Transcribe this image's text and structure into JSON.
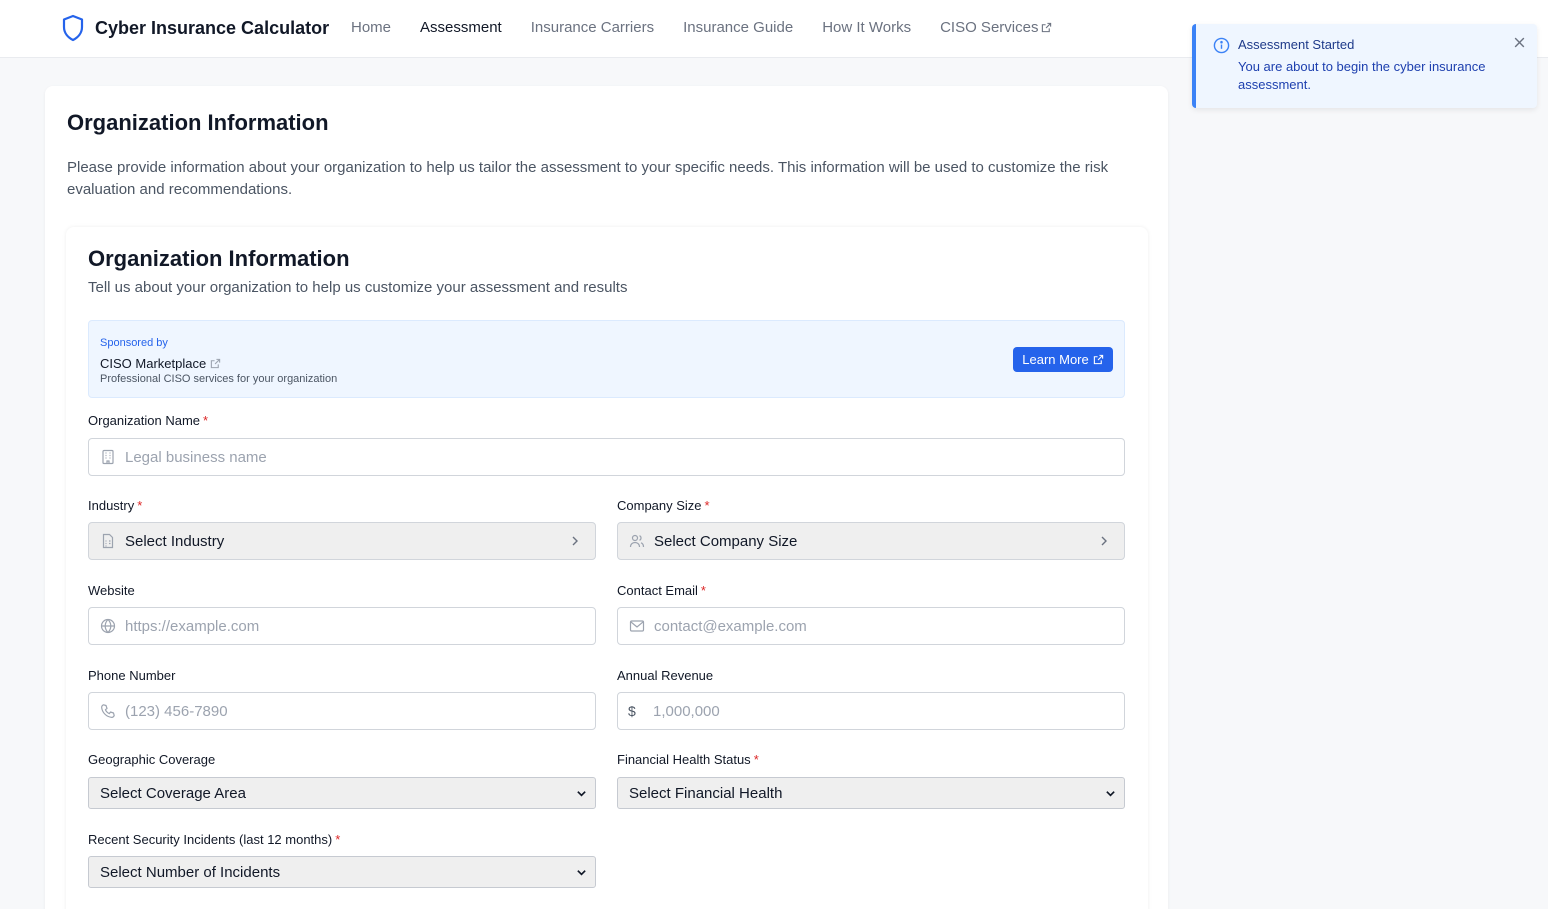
{
  "header": {
    "brand": "Cyber Insurance Calculator",
    "nav": [
      {
        "label": "Home"
      },
      {
        "label": "Assessment",
        "active": true
      },
      {
        "label": "Insurance Carriers"
      },
      {
        "label": "Insurance Guide"
      },
      {
        "label": "How It Works"
      },
      {
        "label": "CISO Services",
        "external": true
      }
    ]
  },
  "toast": {
    "title": "Assessment Started",
    "message": "You are about to begin the cyber insurance assessment."
  },
  "page": {
    "title": "Organization Information",
    "description": "Please provide information about your organization to help us tailor the assessment to your specific needs. This information will be used to customize the risk evaluation and recommendations."
  },
  "form": {
    "title": "Organization Information",
    "subtitle": "Tell us about your organization to help us customize your assessment and results",
    "sponsor": {
      "label": "Sponsored by",
      "name": "CISO Marketplace",
      "description": "Professional CISO services for your organization",
      "button": "Learn More"
    },
    "required_mark": "*",
    "org_name": {
      "label": "Organization Name",
      "placeholder": "Legal business name"
    },
    "industry": {
      "label": "Industry",
      "value": "Select Industry"
    },
    "company_size": {
      "label": "Company Size",
      "value": "Select Company Size"
    },
    "website": {
      "label": "Website",
      "placeholder": "https://example.com"
    },
    "email": {
      "label": "Contact Email",
      "placeholder": "contact@example.com"
    },
    "phone": {
      "label": "Phone Number",
      "placeholder": "(123) 456-7890"
    },
    "revenue": {
      "label": "Annual Revenue",
      "currency": "$",
      "placeholder": "1,000,000"
    },
    "geo": {
      "label": "Geographic Coverage",
      "value": "Select Coverage Area"
    },
    "financial": {
      "label": "Financial Health Status",
      "value": "Select Financial Health"
    },
    "incidents": {
      "label": "Recent Security Incidents (last 12 months)",
      "value": "Select Number of Incidents"
    }
  },
  "colors": {
    "accent": "#2563eb",
    "required": "#dc2626",
    "toast_bg": "#eff6ff",
    "toast_border": "#3b82f6"
  },
  "icons": {
    "brand": "shield-icon",
    "external": "external-link-icon",
    "toast": "info-icon",
    "close": "close-icon",
    "org_name": "building-icon",
    "industry": "document-icon",
    "company_size": "users-icon",
    "website": "globe-icon",
    "email": "mail-icon",
    "phone": "phone-icon"
  }
}
